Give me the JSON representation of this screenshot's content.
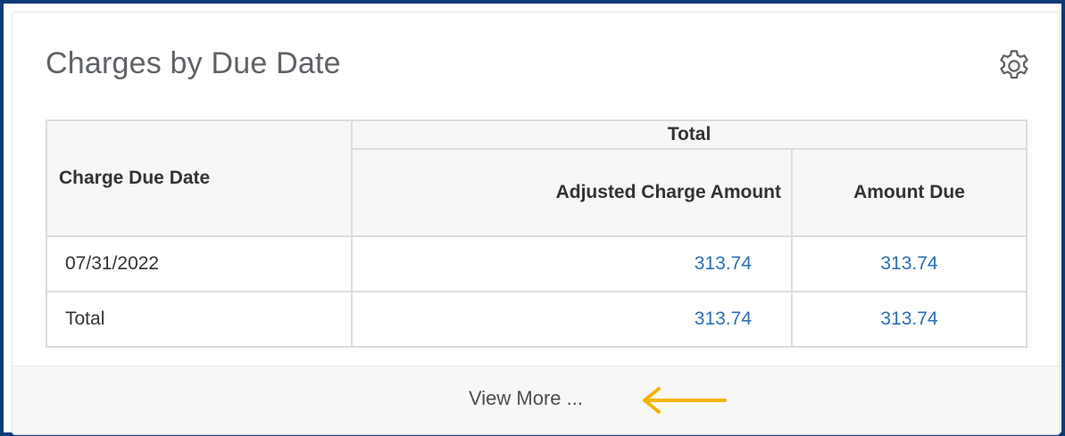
{
  "card": {
    "title": "Charges by Due Date",
    "settings_icon": "gear-icon"
  },
  "table": {
    "group_header": "Total",
    "columns": {
      "date": "Charge Due Date",
      "adjusted": "Adjusted Charge Amount",
      "due": "Amount Due"
    },
    "rows": [
      {
        "label": "07/31/2022",
        "adjusted": "313.74",
        "due": "313.74"
      },
      {
        "label": "Total",
        "adjusted": "313.74",
        "due": "313.74"
      }
    ]
  },
  "footer": {
    "view_more": "View More ...",
    "annotation_icon": "left-arrow-icon",
    "annotation_color": "#f5b400"
  },
  "colors": {
    "frame_border": "#0d3a78",
    "link": "#2a6eb7"
  }
}
